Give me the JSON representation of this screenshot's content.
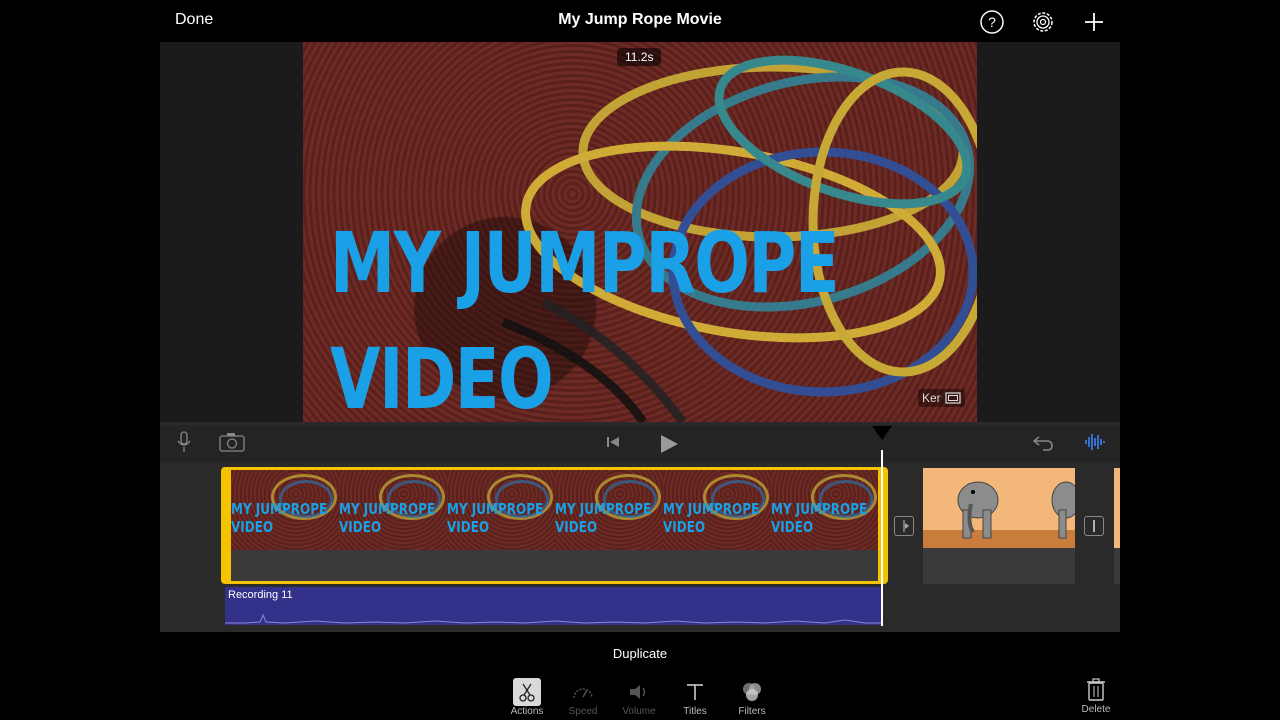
{
  "topbar": {
    "done_label": "Done",
    "title": "My Jump Rope Movie",
    "icons": [
      "help-icon",
      "settings-icon",
      "add-icon"
    ]
  },
  "viewer": {
    "duration_badge": "11.2s",
    "title_line1": "MY JUMPROPE",
    "title_line2": "VIDEO",
    "kenburns_label": "Ker",
    "title_color": "#1aa0e6"
  },
  "timeline": {
    "clip1_thumbs": [
      {
        "line1": "MY JUMPROPE",
        "line2": "VIDEO"
      },
      {
        "line1": "MY JUMPROPE",
        "line2": "VIDEO"
      },
      {
        "line1": "MY JUMPROPE",
        "line2": "VIDEO"
      },
      {
        "line1": "MY JUMPROPE",
        "line2": "VIDEO"
      },
      {
        "line1": "MY JUMPROPE",
        "line2": "VIDEO"
      },
      {
        "line1": "MY JUMPROPE",
        "line2": "VIDEO"
      }
    ],
    "audio_label": "Recording 11",
    "selection_color": "#f5c400",
    "audio_color": "#34318a"
  },
  "bottom": {
    "context_label": "Duplicate",
    "tools": {
      "actions": "Actions",
      "speed": "Speed",
      "volume": "Volume",
      "titles": "Titles",
      "filters": "Filters"
    },
    "delete_label": "Delete"
  }
}
